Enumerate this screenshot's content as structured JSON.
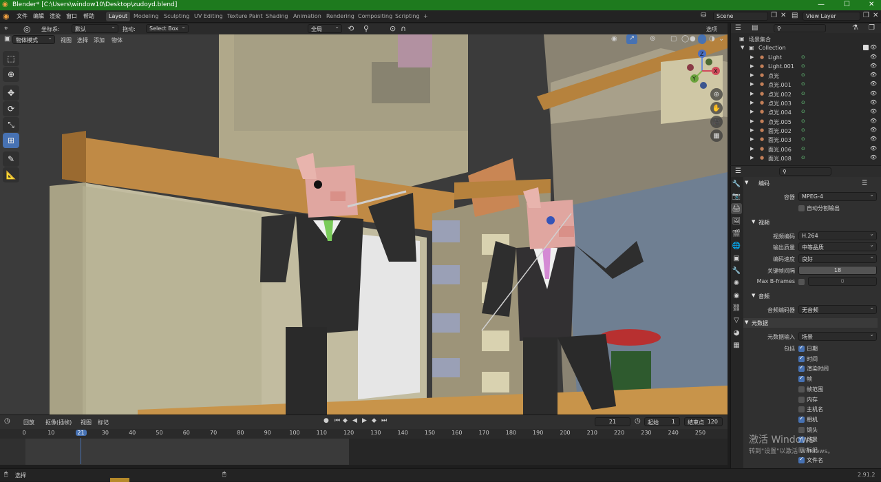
{
  "titlebar": {
    "title": "Blender* [C:\\Users\\window10\\Desktop\\zudoyd.blend]",
    "minimize": "—",
    "maximize": "☐",
    "close": "✕"
  },
  "menu": [
    "文件",
    "编辑",
    "渲染",
    "窗口",
    "帮助"
  ],
  "workspaces": [
    "Layout",
    "Modeling",
    "Sculpting",
    "UV Editing",
    "Texture Paint",
    "Shading",
    "Animation",
    "Rendering",
    "Compositing",
    "Scripting",
    "+"
  ],
  "scene_name": "Scene",
  "view_layer": "View Layer",
  "toolrow": {
    "coord_label": "坐标系:",
    "coord_value": "默认",
    "drag_label": "拖动:",
    "drag_value": "Select Box",
    "pivot": "全局",
    "options": "选项"
  },
  "viewport_header": {
    "mode": "物体模式",
    "menus": [
      "视图",
      "选择",
      "添加",
      "物体"
    ]
  },
  "gizmo": {
    "x": "X",
    "y": "Y",
    "z": "Z"
  },
  "outliner": {
    "root": "场景集合",
    "collection": "Collection",
    "items": [
      "Light",
      "Light.001",
      "点光",
      "点光.001",
      "点光.002",
      "点光.003",
      "点光.004",
      "点光.005",
      "面光.002",
      "面光.003",
      "面光.006",
      "面光.008"
    ]
  },
  "properties": {
    "encoding_section": "编码",
    "container_label": "容器",
    "container_value": "MPEG-4",
    "autosplit_label": "自动分割输出",
    "video_section": "视频",
    "codec_label": "视频编码",
    "codec_value": "H.264",
    "quality_label": "输出质量",
    "quality_value": "中等品质",
    "speed_label": "编码速度",
    "speed_value": "良好",
    "keyframe_label": "关键帧间隔",
    "keyframe_value": "18",
    "bframes_label": "Max B-frames",
    "bframes_value": "0",
    "audio_section": "音频",
    "audio_codec_label": "音频编码器",
    "audio_codec_value": "无音频",
    "metadata_section": "元数据",
    "metadata_input_label": "元数据输入",
    "metadata_input_value": "场景",
    "include_label": "包括",
    "include_items": [
      {
        "label": "日期",
        "checked": true
      },
      {
        "label": "时间",
        "checked": true
      },
      {
        "label": "渲染时间",
        "checked": true
      },
      {
        "label": "帧",
        "checked": true
      },
      {
        "label": "帧范围",
        "checked": false
      },
      {
        "label": "内存",
        "checked": false
      },
      {
        "label": "主机名",
        "checked": false
      },
      {
        "label": "相机",
        "checked": true
      },
      {
        "label": "镜头",
        "checked": false
      },
      {
        "label": "场景",
        "checked": true
      },
      {
        "label": "标记",
        "checked": false
      },
      {
        "label": "文件名",
        "checked": true
      }
    ]
  },
  "timeline": {
    "menus": [
      "回放",
      "抠像(插帧)",
      "视图",
      "标记"
    ],
    "current_frame": "21",
    "start_label": "起始",
    "start_value": "1",
    "end_label": "结束点",
    "end_value": "120",
    "ticks": [
      "0",
      "10",
      "21",
      "30",
      "40",
      "50",
      "60",
      "70",
      "80",
      "90",
      "100",
      "110",
      "120",
      "130",
      "140",
      "150",
      "160",
      "170",
      "180",
      "190",
      "200",
      "210",
      "220",
      "230",
      "240",
      "250"
    ],
    "playhead_frame": 21
  },
  "status": {
    "left": "选择",
    "version": "2.91.2"
  },
  "watermark": {
    "line1": "激活 Windows",
    "line2": "转到\"设置\"以激活 Windows。"
  },
  "colors": {
    "accent": "#4772b3",
    "titlebar": "#1e7a1e",
    "frame_highlight": "#4772b3"
  }
}
